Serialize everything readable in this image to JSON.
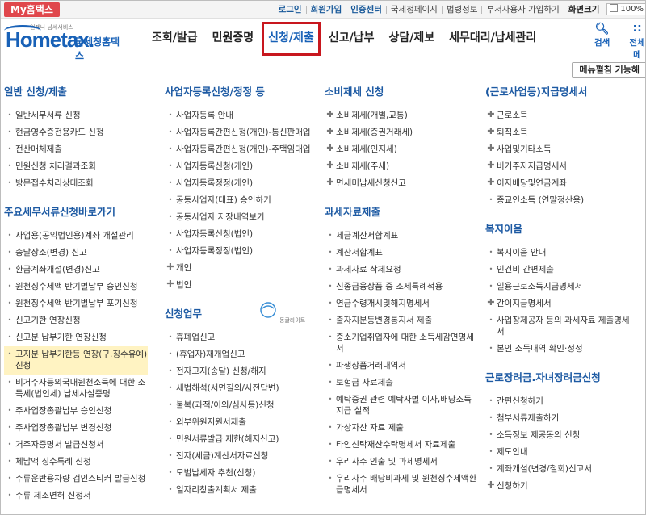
{
  "topbar": {
    "my_tab": "My홈택스",
    "links": [
      "로그인",
      "회원가입",
      "인증센터",
      "국세청페이지",
      "법령정보",
      "부서사용자 가입하기",
      "화면크기"
    ],
    "zoom": "100%"
  },
  "header": {
    "logo_small": "언제나 남세서비스",
    "logo_home": "Hometax.",
    "logo_kor": "국세청홈택스",
    "nav": [
      "조회/발급",
      "민원증명",
      "신청/제출",
      "신고/납부",
      "상담/제보",
      "세무대리/납세관리"
    ],
    "search_label": "검색",
    "all_label": "전체메"
  },
  "menu_toggle": "메뉴펼침 기능해",
  "columns": [
    {
      "sections": [
        {
          "title": "일반 신청/제출",
          "items": [
            {
              "t": "일반세무서류 신청",
              "b": "dot"
            },
            {
              "t": "현금영수증전용카드 신청",
              "b": "dot"
            },
            {
              "t": "전산매체제출",
              "b": "dot"
            },
            {
              "t": "민원신청 처리결과조회",
              "b": "dot"
            },
            {
              "t": "방문접수처리상태조회",
              "b": "dot"
            }
          ]
        },
        {
          "title": "주요세무서류신청바로가기",
          "items": [
            {
              "t": "사업용(공익법인용)계좌 개설관리",
              "b": "dot"
            },
            {
              "t": "송달장소(변경) 신고",
              "b": "dot"
            },
            {
              "t": "환급계좌개설(변경)신고",
              "b": "dot"
            },
            {
              "t": "원천징수세액 반기별납부 승인신청",
              "b": "dot"
            },
            {
              "t": "원천징수세액 반기별납부 포기신청",
              "b": "dot"
            },
            {
              "t": "신고기한 연장신청",
              "b": "dot"
            },
            {
              "t": "신고분 납부기한 연장신청",
              "b": "dot"
            },
            {
              "t": "고지분 납부기한등 연장(구.징수유예)신청",
              "b": "dot",
              "hl": true
            },
            {
              "t": "비거주자등의국내원천소득에 대한 소득세(법인세) 납세사실증명",
              "b": "dot"
            },
            {
              "t": "주사업장총괄납부 승인신청",
              "b": "dot"
            },
            {
              "t": "주사업장총괄납부 변경신청",
              "b": "dot"
            },
            {
              "t": "거주자증명서 발급신청서",
              "b": "dot"
            },
            {
              "t": "체납액 징수특례 신청",
              "b": "dot"
            },
            {
              "t": "주류운반용차량 검인스티커 발급신청",
              "b": "dot"
            },
            {
              "t": "주류 제조면허 신청서",
              "b": "dot"
            }
          ]
        }
      ]
    },
    {
      "sections": [
        {
          "title": "사업자등록신청/정정 등",
          "items": [
            {
              "t": "사업자등록 안내",
              "b": "dot"
            },
            {
              "t": "사업자등록간편신청(개인)-통신판매업",
              "b": "dot"
            },
            {
              "t": "사업자등록간편신청(개인)-주택임대업",
              "b": "dot"
            },
            {
              "t": "사업자등록신청(개인)",
              "b": "dot"
            },
            {
              "t": "사업자등록정정(개인)",
              "b": "dot"
            },
            {
              "t": "공동사업자(대표) 승인하기",
              "b": "dot"
            },
            {
              "t": "공동사업자 저장내역보기",
              "b": "dot"
            },
            {
              "t": "사업자등록신청(법인)",
              "b": "dot"
            },
            {
              "t": "사업자등록정정(법인)",
              "b": "dot"
            },
            {
              "t": "개인",
              "b": "plus"
            },
            {
              "t": "법인",
              "b": "plus"
            }
          ]
        },
        {
          "title": "신청업무",
          "items": [
            {
              "t": "휴폐업신고",
              "b": "dot"
            },
            {
              "t": "(휴업자)재개업신고",
              "b": "dot"
            },
            {
              "t": "전자고지(송달) 신청/해지",
              "b": "dot"
            },
            {
              "t": "세법해석(서면질의/사전답변)",
              "b": "dot"
            },
            {
              "t": "불복(과적/이의/심사등)신청",
              "b": "dot"
            },
            {
              "t": "외부위원지원서제출",
              "b": "dot"
            },
            {
              "t": "민원서류발급 제한(해지신고)",
              "b": "dot"
            },
            {
              "t": "전자(세금)계산서자료신청",
              "b": "dot"
            },
            {
              "t": "모범납세자 추천(신청)",
              "b": "dot"
            },
            {
              "t": "일자리창출계획서 제출",
              "b": "dot"
            }
          ]
        }
      ],
      "mascot_text": "동글라이트"
    },
    {
      "sections": [
        {
          "title": "소비제세 신청",
          "items": [
            {
              "t": "소비제세(개별,교통)",
              "b": "plus"
            },
            {
              "t": "소비제세(증권거래세)",
              "b": "plus"
            },
            {
              "t": "소비제세(인지세)",
              "b": "plus"
            },
            {
              "t": "소비제세(주세)",
              "b": "plus"
            },
            {
              "t": "면세미납세신청신고",
              "b": "plus"
            }
          ]
        },
        {
          "title": "과세자료제출",
          "items": [
            {
              "t": "세금계산서합계표",
              "b": "dot"
            },
            {
              "t": "계산서합계표",
              "b": "dot"
            },
            {
              "t": "과세자료 삭제요청",
              "b": "dot"
            },
            {
              "t": "신종금융상품 중 조세특례적용",
              "b": "dot"
            },
            {
              "t": "연금수령개시및해지명세서",
              "b": "dot"
            },
            {
              "t": "출자지분등변경통지서 제출",
              "b": "dot"
            },
            {
              "t": "중소기업취업자에 대한 소득세감면명세서",
              "b": "dot"
            },
            {
              "t": "파생상품거래내역서",
              "b": "dot"
            },
            {
              "t": "보험금 자료제출",
              "b": "dot"
            },
            {
              "t": "예탁증권 관련 예탁자별 이자,배당소득지급 실적",
              "b": "dot"
            },
            {
              "t": "가상자산 자료 제출",
              "b": "dot"
            },
            {
              "t": "타인신탁재산수탁명세서 자료제출",
              "b": "dot"
            },
            {
              "t": "우리사주 인출 및 과세명세서",
              "b": "dot"
            },
            {
              "t": "우리사주 배당비과세 및 원천징수세액환급명세서",
              "b": "dot"
            }
          ]
        }
      ]
    },
    {
      "sections": [
        {
          "title": "(근로사업등)지급명세서",
          "items": [
            {
              "t": "근로소득",
              "b": "plus"
            },
            {
              "t": "퇴직소득",
              "b": "plus"
            },
            {
              "t": "사업및기타소득",
              "b": "plus"
            },
            {
              "t": "비거주자지급명세서",
              "b": "plus"
            },
            {
              "t": "이자배당및연금계좌",
              "b": "plus"
            },
            {
              "t": "종교인소득 (연말정산용)",
              "b": "dot"
            }
          ]
        },
        {
          "title": "복지이음",
          "items": [
            {
              "t": "복지이음 안내",
              "b": "dot"
            },
            {
              "t": "인건비 간편제출",
              "b": "dot"
            },
            {
              "t": "일용근로소득지급명세서",
              "b": "dot"
            },
            {
              "t": "간이지급명세서",
              "b": "plus"
            },
            {
              "t": "사업장제공자 등의 과세자료 제출명세서",
              "b": "dot"
            },
            {
              "t": "본인 소득내역 확인·정정",
              "b": "dot"
            }
          ]
        },
        {
          "title": "근로장려금.자녀장려금신청",
          "items": [
            {
              "t": "간편신청하기",
              "b": "dot"
            },
            {
              "t": "첨부서류제출하기",
              "b": "dot"
            },
            {
              "t": "소득정보 제공동의 신청",
              "b": "dot"
            },
            {
              "t": "제도안내",
              "b": "dot"
            },
            {
              "t": "계좌개설(변경/철회)신고서",
              "b": "dot"
            },
            {
              "t": "신청하기",
              "b": "plus"
            }
          ]
        }
      ]
    }
  ]
}
